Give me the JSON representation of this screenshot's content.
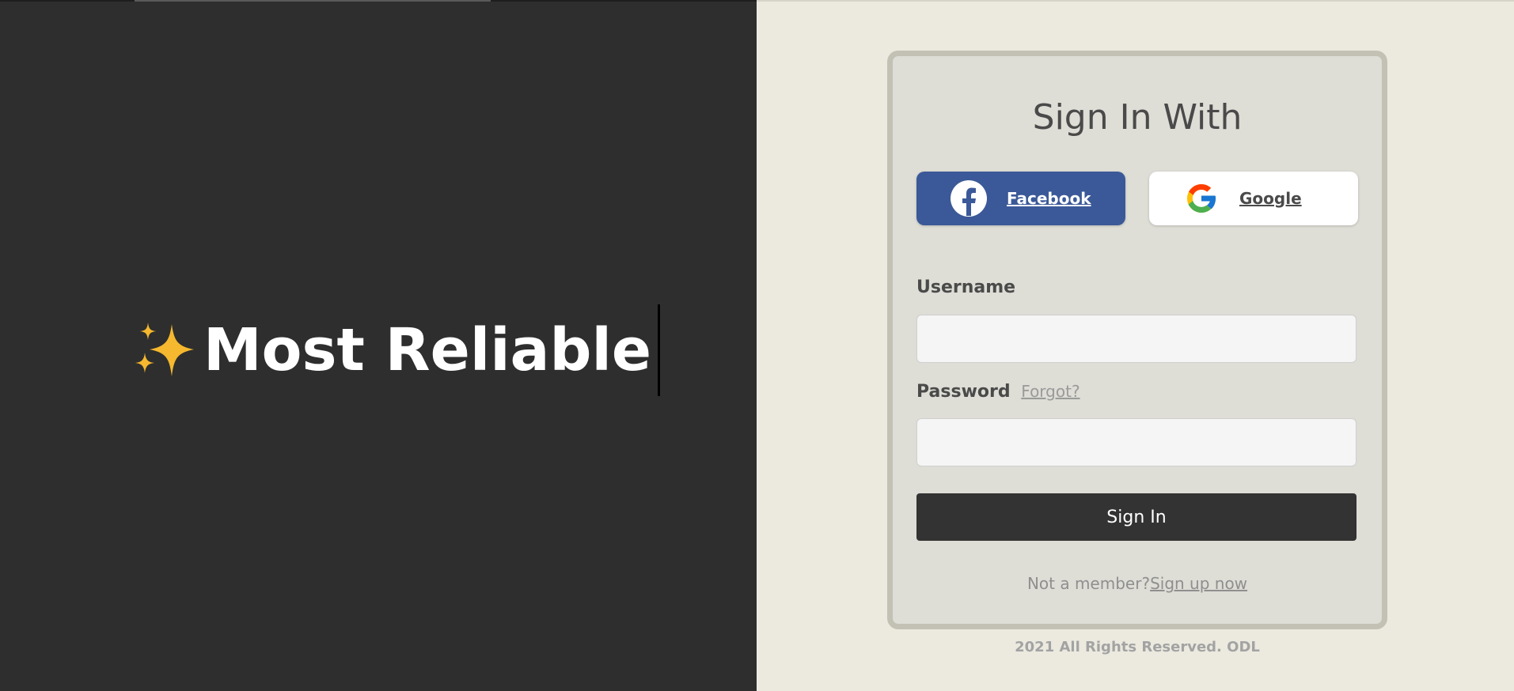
{
  "hero": {
    "title": "Most Reliable",
    "icon": "sparkles-icon",
    "icon_color": "#f5b82e"
  },
  "login": {
    "title": "Sign In With",
    "facebook_label": "Facebook",
    "google_label": "Google",
    "username_label": "Username",
    "username_value": "",
    "password_label": "Password",
    "password_value": "",
    "forgot_label": "Forgot?",
    "signin_label": "Sign In",
    "not_member_text": "Not a member?",
    "signup_label": "Sign up now"
  },
  "footer": {
    "text": "2021 All Rights Reserved. ODL"
  },
  "colors": {
    "left_bg": "#2e2e2e",
    "right_bg": "#eceadf",
    "card_bg": "#deddd6",
    "facebook_blue": "#3b5998",
    "signin_btn": "#333333"
  }
}
